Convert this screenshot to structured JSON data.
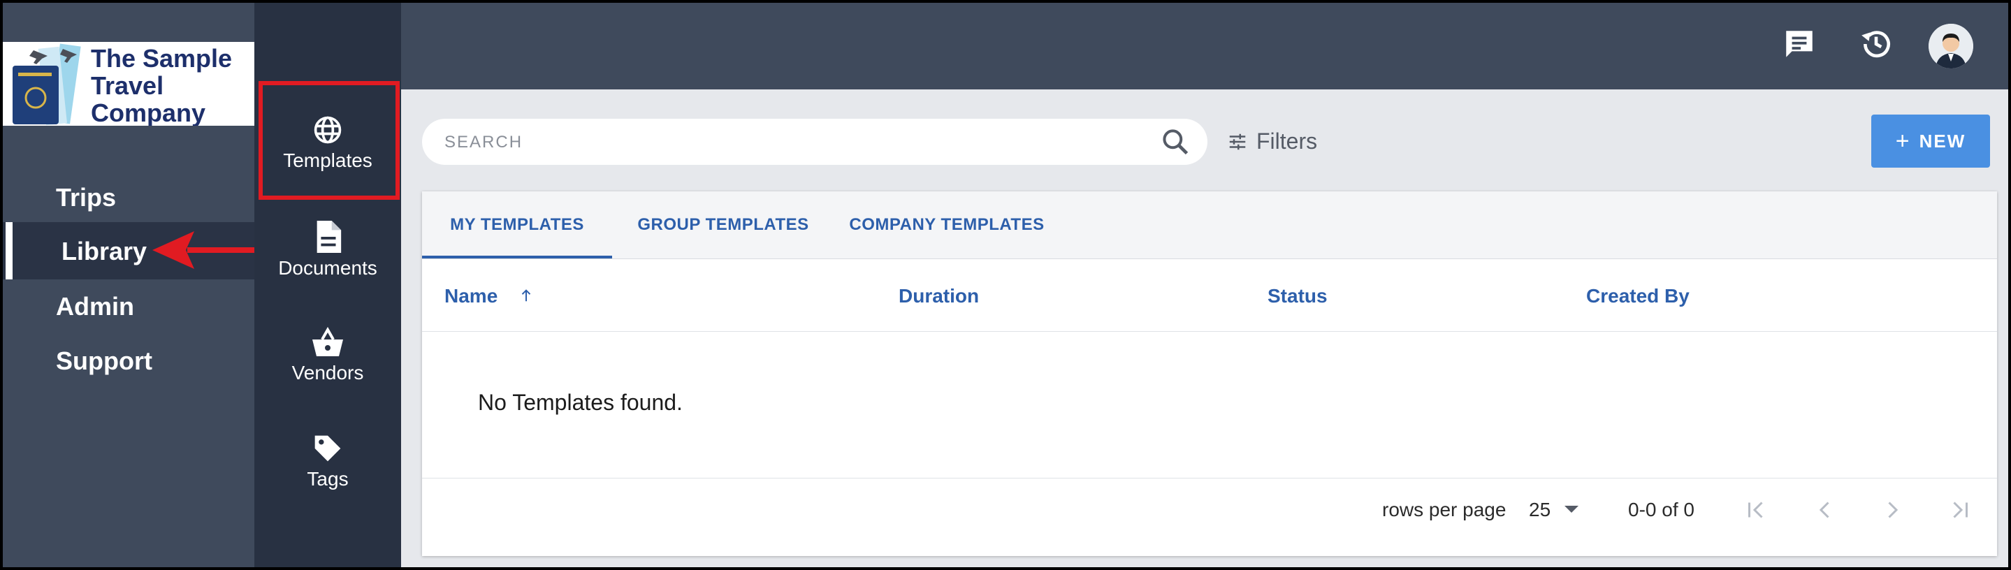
{
  "brand": {
    "name_line1": "The Sample",
    "name_line2": "Travel",
    "name_line3": "Company"
  },
  "nav": {
    "items": [
      {
        "label": "Trips"
      },
      {
        "label": "Library"
      },
      {
        "label": "Admin"
      },
      {
        "label": "Support"
      }
    ],
    "active": "Library"
  },
  "library_menu": {
    "items": [
      {
        "label": "Templates",
        "icon": "globe-icon"
      },
      {
        "label": "Documents",
        "icon": "document-icon"
      },
      {
        "label": "Vendors",
        "icon": "basket-icon"
      },
      {
        "label": "Tags",
        "icon": "tag-icon"
      }
    ],
    "active": "Templates"
  },
  "header": {
    "icons": [
      "chat-icon",
      "history-icon",
      "avatar"
    ]
  },
  "search": {
    "placeholder": "SEARCH"
  },
  "filters": {
    "label": "Filters"
  },
  "new_button": {
    "label": "NEW"
  },
  "tabs": [
    {
      "label": "MY TEMPLATES",
      "active": true
    },
    {
      "label": "GROUP TEMPLATES",
      "active": false
    },
    {
      "label": "COMPANY TEMPLATES",
      "active": false
    }
  ],
  "table": {
    "columns": [
      {
        "label": "Name",
        "sort": "asc"
      },
      {
        "label": "Duration"
      },
      {
        "label": "Status"
      },
      {
        "label": "Created By"
      }
    ],
    "empty_message": "No Templates found."
  },
  "pagination": {
    "rows_per_page_label": "rows per page",
    "rows_per_page": "25",
    "range": "0-0 of 0"
  },
  "colors": {
    "accent": "#2d5fab",
    "highlight": "#e11b22",
    "button": "#4a90e2",
    "nav_bg": "#3f4a5c",
    "iconcol_bg": "#283142"
  }
}
